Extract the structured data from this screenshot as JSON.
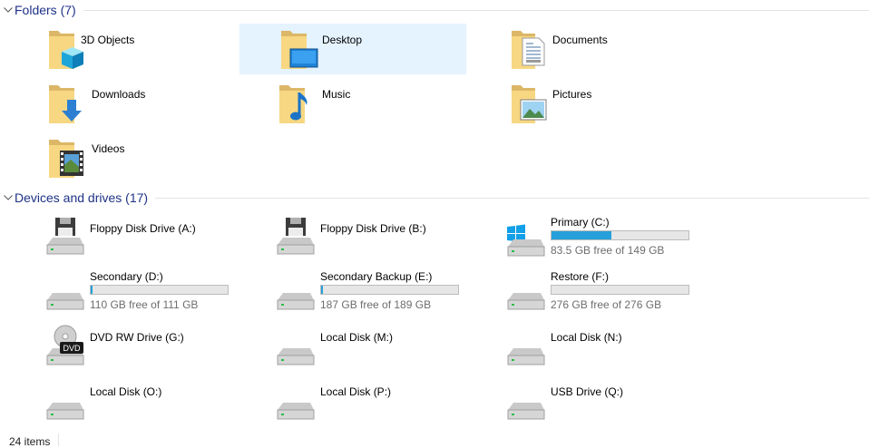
{
  "folders_header": {
    "title": "Folders (7)"
  },
  "drives_header": {
    "title": "Devices and drives (17)"
  },
  "folders": [
    {
      "label": "3D Objects",
      "icon": "3d-objects-icon"
    },
    {
      "label": "Desktop",
      "icon": "desktop-icon",
      "selected": true
    },
    {
      "label": "Documents",
      "icon": "documents-icon"
    },
    {
      "label": "Downloads",
      "icon": "downloads-icon"
    },
    {
      "label": "Music",
      "icon": "music-icon"
    },
    {
      "label": "Pictures",
      "icon": "pictures-icon"
    },
    {
      "label": "Videos",
      "icon": "videos-icon"
    }
  ],
  "drives": [
    {
      "label": "Floppy Disk Drive (A:)",
      "icon": "floppy-drive-icon"
    },
    {
      "label": "Floppy Disk Drive (B:)",
      "icon": "floppy-drive-icon"
    },
    {
      "label": "Primary (C:)",
      "icon": "windows-drive-icon",
      "free_text": "83.5 GB free of 149 GB",
      "used_fraction": 0.44
    },
    {
      "label": "Secondary (D:)",
      "icon": "hard-drive-icon",
      "free_text": "110 GB free of 111 GB",
      "used_fraction": 0.01
    },
    {
      "label": "Secondary Backup (E:)",
      "icon": "hard-drive-icon",
      "free_text": "187 GB free of 189 GB",
      "used_fraction": 0.01
    },
    {
      "label": "Restore (F:)",
      "icon": "hard-drive-icon",
      "free_text": "276 GB free of 276 GB",
      "used_fraction": 0.0
    },
    {
      "label": "DVD RW Drive (G:)",
      "icon": "dvd-drive-icon",
      "dvd_badge": "DVD"
    },
    {
      "label": "Local Disk (M:)",
      "icon": "hard-drive-icon"
    },
    {
      "label": "Local Disk (N:)",
      "icon": "hard-drive-icon"
    },
    {
      "label": "Local Disk (O:)",
      "icon": "hard-drive-icon"
    },
    {
      "label": "Local Disk (P:)",
      "icon": "hard-drive-icon"
    },
    {
      "label": "USB Drive (Q:)",
      "icon": "hard-drive-icon"
    }
  ],
  "status_bar": {
    "item_count": "24 items"
  },
  "colors": {
    "header_text": "#1e3287",
    "selection": "#e5f3ff",
    "capacity_fill": "#26a0da"
  }
}
